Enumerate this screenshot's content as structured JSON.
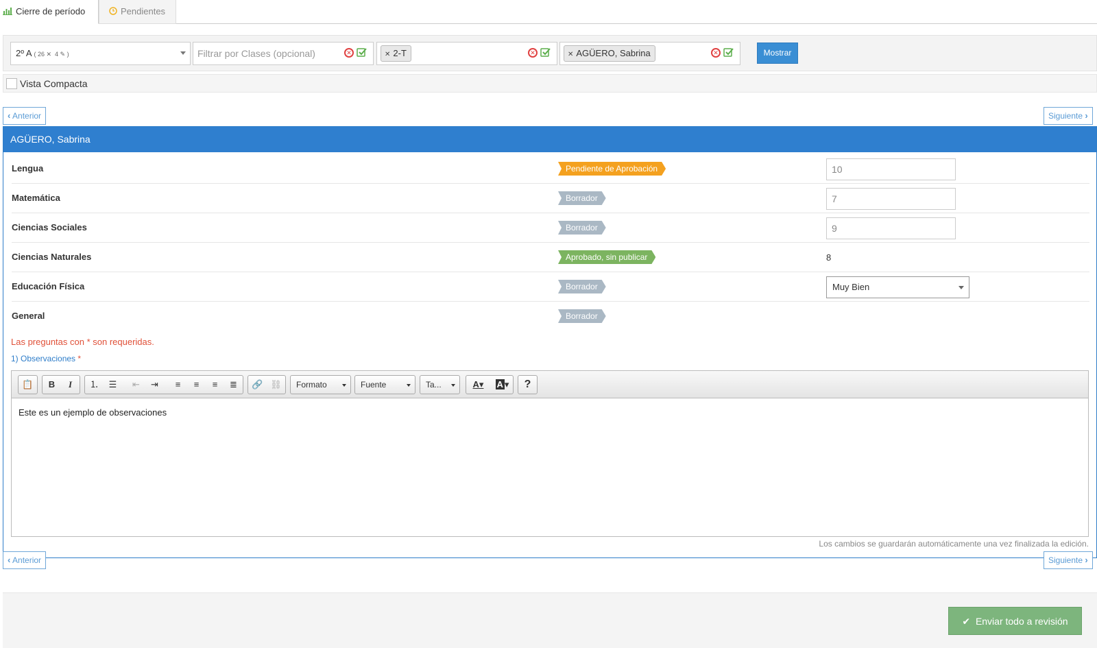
{
  "tabs": [
    {
      "label": "Cierre de período",
      "icon": "bar-chart-icon",
      "active": true
    },
    {
      "label": "Pendientes",
      "icon": "clock-icon",
      "active": false
    }
  ],
  "filters": {
    "course": {
      "label": "2º A",
      "count_students": "26",
      "count_edited": "4"
    },
    "classes": {
      "placeholder": "Filtrar por Clases (opcional)"
    },
    "period": {
      "tag": "2-T"
    },
    "student": {
      "tag": "AGÜERO, Sabrina"
    },
    "show_button": "Mostrar"
  },
  "compact_view": {
    "label": "Vista Compacta",
    "checked": false
  },
  "nav": {
    "prev": "Anterior",
    "next": "Siguiente"
  },
  "student_panel": {
    "name": "AGÜERO, Sabrina",
    "rows": [
      {
        "subject": "Lengua",
        "status": "Pendiente de Aprobación",
        "status_color": "#f4a11f",
        "grade": "10",
        "grade_type": "input"
      },
      {
        "subject": "Matemática",
        "status": "Borrador",
        "status_color": "#aab8c4",
        "grade": "7",
        "grade_type": "input"
      },
      {
        "subject": "Ciencias Sociales",
        "status": "Borrador",
        "status_color": "#aab8c4",
        "grade": "9",
        "grade_type": "input"
      },
      {
        "subject": "Ciencias Naturales",
        "status": "Aprobado, sin publicar",
        "status_color": "#7cb460",
        "grade": "8",
        "grade_type": "text"
      },
      {
        "subject": "Educación Física",
        "status": "Borrador",
        "status_color": "#aab8c4",
        "grade": "Muy Bien",
        "grade_type": "select"
      },
      {
        "subject": "General",
        "status": "Borrador",
        "status_color": "#aab8c4",
        "grade": "",
        "grade_type": "none"
      }
    ],
    "required_note": "Las preguntas con * son requeridas.",
    "question": {
      "label": "1) Observaciones",
      "required_mark": "*"
    },
    "editor": {
      "format_label": "Formato",
      "font_label": "Fuente",
      "size_label": "Ta...",
      "content": "Este es un ejemplo de observaciones"
    },
    "autosave_note": "Los cambios se guardarán automáticamente una vez finalizada la edición."
  },
  "submit_button": "Enviar todo a revisión",
  "colors": {
    "primary": "#2f7fcf",
    "success": "#7db57d",
    "danger": "#e05038"
  }
}
